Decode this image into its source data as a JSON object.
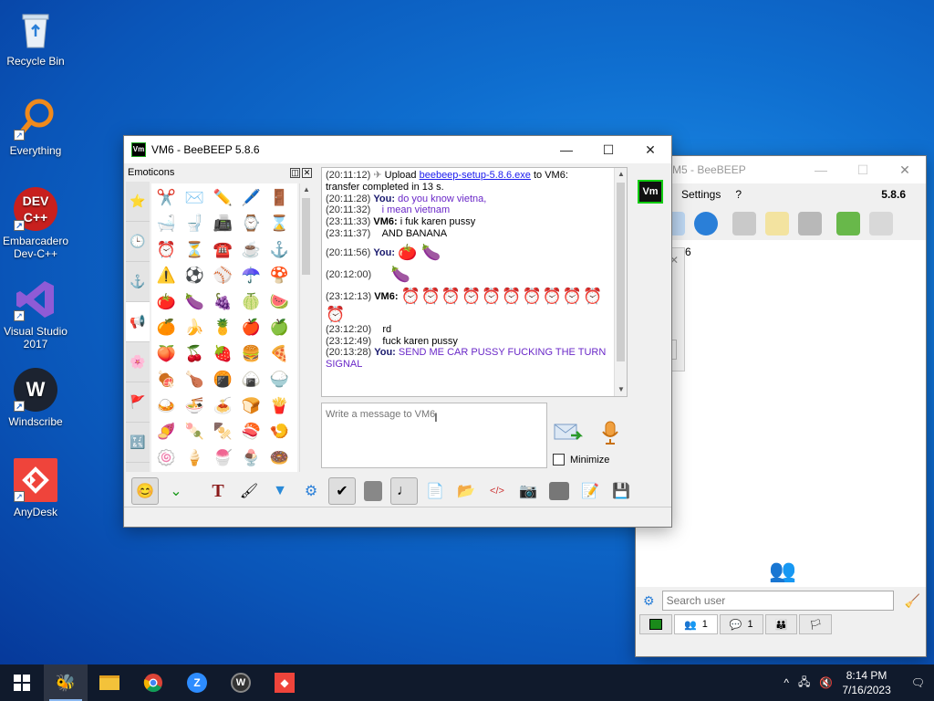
{
  "desktop": {
    "icons": [
      {
        "label": "Recycle Bin"
      },
      {
        "label": "Everything"
      },
      {
        "label": "Embarcadero Dev-C++"
      },
      {
        "label": "Visual Studio 2017"
      },
      {
        "label": "Windscribe"
      },
      {
        "label": "AnyDesk"
      }
    ]
  },
  "back_window": {
    "title": "VM5 - BeeBEEP",
    "menu": [
      "Settings",
      "?"
    ],
    "version": "5.8.6",
    "partial_label": "6",
    "search_placeholder": "Search user",
    "tabs": [
      {
        "icon": "chip-icon",
        "count": ""
      },
      {
        "icon": "users-icon",
        "count": "1"
      },
      {
        "icon": "chat-icon",
        "count": "1"
      },
      {
        "icon": "group-icon",
        "count": ""
      },
      {
        "icon": "flag-icon",
        "count": ""
      }
    ]
  },
  "main_window": {
    "title": "VM6 - BeeBEEP 5.8.6",
    "app_icon_text": "Vm",
    "emoticons_header": "Emoticons",
    "categories": [
      "⭐",
      "🕒",
      "⚓",
      "📢",
      "🌸",
      "🚩",
      "🔣"
    ],
    "emojis": [
      "✂️",
      "✉️",
      "✏️",
      "🖊️",
      "🚪",
      "🛁",
      "🚽",
      "📠",
      "⌚",
      "⌛",
      "⏰",
      "⏳",
      "☎️",
      "☕",
      "⚓",
      "⚠️",
      "⚽",
      "⚾",
      "☂️",
      "🍄",
      "🍅",
      "🍆",
      "🍇",
      "🍈",
      "🍉",
      "🍊",
      "🍌",
      "🍍",
      "🍎",
      "🍏",
      "🍑",
      "🍒",
      "🍓",
      "🍔",
      "🍕",
      "🍖",
      "🍗",
      "🍘",
      "🍙",
      "🍚",
      "🍛",
      "🍜",
      "🍝",
      "🍞",
      "🍟",
      "🍠",
      "🍡",
      "🍢",
      "🍣",
      "🍤",
      "🍥",
      "🍦",
      "🍧",
      "🍨",
      "🍩"
    ],
    "chat": {
      "upload_ts": "(20:11:12)",
      "upload_pre": "Upload",
      "upload_link": "beebeep-setup-5.8.6.exe",
      "upload_post": "to VM6:",
      "upload_line2": "transfer completed in 13 s.",
      "lines": [
        {
          "ts": "(20:11:28)",
          "who": "You:",
          "text": "do you know vietna,"
        },
        {
          "ts": "(20:11:32)",
          "who": "",
          "text": "i mean vietnam"
        },
        {
          "ts": "(23:11:33)",
          "who": "VM6:",
          "text": "i fuk karen pussy"
        },
        {
          "ts": "(23:11:37)",
          "who": "",
          "text": "AND BANANA"
        }
      ],
      "emo1_ts": "(20:11:56)",
      "emo1_who": "You:",
      "emo1": "🍅 🍆",
      "emo2_ts": "(20:12:00)",
      "emo2": "🍆",
      "emo3_ts": "(23:12:13)",
      "emo3_who": "VM6:",
      "emo3": "⏰⏰⏰⏰⏰⏰⏰⏰⏰⏰⏰",
      "tail": [
        {
          "ts": "(23:12:20)",
          "text": "rd"
        },
        {
          "ts": "(23:12:49)",
          "text": "fuck karen pussy"
        }
      ],
      "last_ts": "(20:13:28)",
      "last_who": "You:",
      "last_text": "SEND ME CAR PUSSY FUCKING THE TURN SIGNAL"
    },
    "avatar_text": "Vm",
    "message_placeholder": "Write a message to VM6",
    "minimize_label": "Minimize"
  },
  "taskbar": {
    "time": "8:14 PM",
    "date": "7/16/2023"
  },
  "colors": {
    "accent": "#0078d7",
    "chat_self_text": "#6a28c8",
    "link": "#1a1aee"
  }
}
